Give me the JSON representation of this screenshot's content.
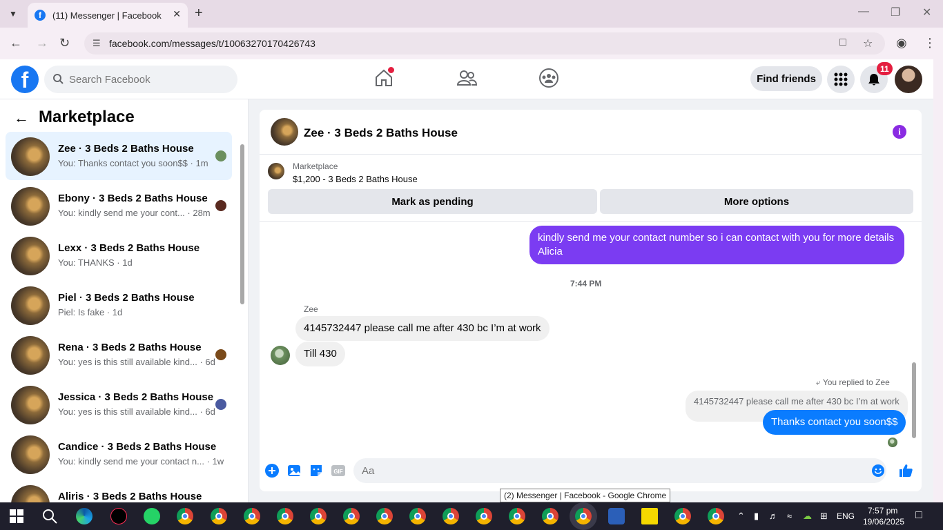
{
  "browser": {
    "tab_title": "(11) Messenger | Facebook",
    "url": "facebook.com/messages/t/10063270170426743",
    "tooltip": "(2) Messenger | Facebook - Google Chrome"
  },
  "fb_header": {
    "logo_letter": "f",
    "search_placeholder": "Search Facebook",
    "find_friends_label": "Find friends",
    "notification_count": "11"
  },
  "left_panel": {
    "title": "Marketplace",
    "conversations": [
      {
        "name": "Zee · 3 Beds 2 Baths House",
        "preview": "You: Thanks contact you soon$$ · 1m",
        "active": true
      },
      {
        "name": "Ebony · 3 Beds 2 Baths House",
        "preview": "You: kindly send me your cont... · 28m"
      },
      {
        "name": "Lexx · 3 Beds 2 Baths House",
        "preview": "You: THANKS · 1d"
      },
      {
        "name": "Piel · 3 Beds 2 Baths House",
        "preview": "Piel: Is fake · 1d"
      },
      {
        "name": "Rena · 3 Beds 2 Baths House",
        "preview": "You: yes is this still available kind... · 6d"
      },
      {
        "name": "Jessica · 3 Beds 2 Baths House",
        "preview": "You: yes is this still available kind... · 6d"
      },
      {
        "name": "Candice · 3 Beds 2 Baths House",
        "preview": "You: kindly send me your contact n... · 1w"
      },
      {
        "name": "Aliris · 3 Beds 2 Baths House",
        "preview": ""
      }
    ]
  },
  "chat": {
    "title": "Zee · 3 Beds 2 Baths House",
    "listing_category": "Marketplace",
    "listing_name": "$1,200 - 3 Beds 2 Baths House",
    "mark_pending_label": "Mark as pending",
    "more_options_label": "More options",
    "messages": {
      "outgoing_1": "kindly send me your contact number so i can contact with you for more details Alicia",
      "time_1": "7:44 PM",
      "sender_name": "Zee",
      "incoming_1": "4145732447 please call me after 430 bc I’m at work",
      "incoming_2": "Till 430",
      "replied_label": "You replied to Zee",
      "quoted": "4145732447 please call me after 430 bc I’m at work",
      "outgoing_2": "Thanks contact you soon$$"
    },
    "composer_placeholder": "Aa"
  },
  "taskbar": {
    "lang": "ENG",
    "time": "7:57 pm",
    "date": "19/06/2025"
  },
  "colors": {
    "fb_blue": "#1877f2",
    "outgoing_purple": "#7b3cf2",
    "outgoing_blue": "#0a7cff",
    "badge_red": "#e41e3f"
  }
}
